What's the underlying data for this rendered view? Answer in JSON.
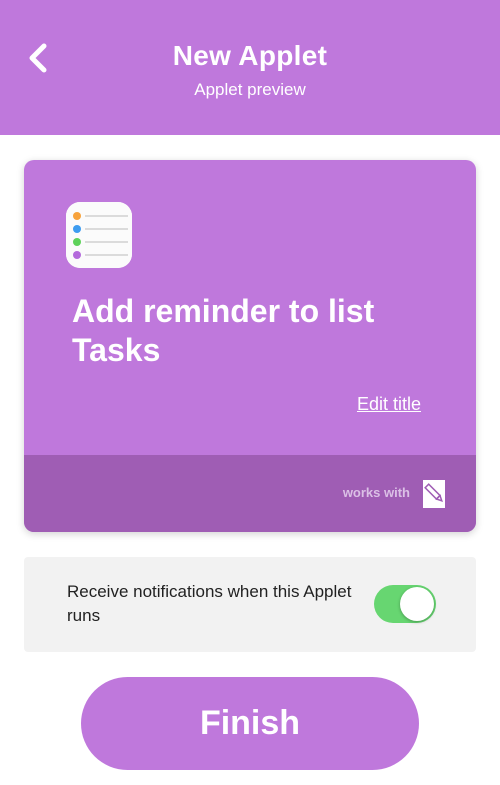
{
  "header": {
    "title": "New Applet",
    "subtitle": "Applet preview",
    "back_icon": "chevron-left-icon"
  },
  "card": {
    "app_icon": "reminders-icon",
    "title": "Add reminder to list Tasks",
    "edit_title_label": "Edit title",
    "works_with_label": "works with",
    "service_icon": "note-pencil-icon"
  },
  "notifications": {
    "label": "Receive notifications when this Applet runs",
    "enabled": true
  },
  "finish_label": "Finish",
  "colors": {
    "brand_purple": "#bf78dc",
    "footer_purple": "#9f5db4",
    "toggle_on": "#67d671"
  }
}
